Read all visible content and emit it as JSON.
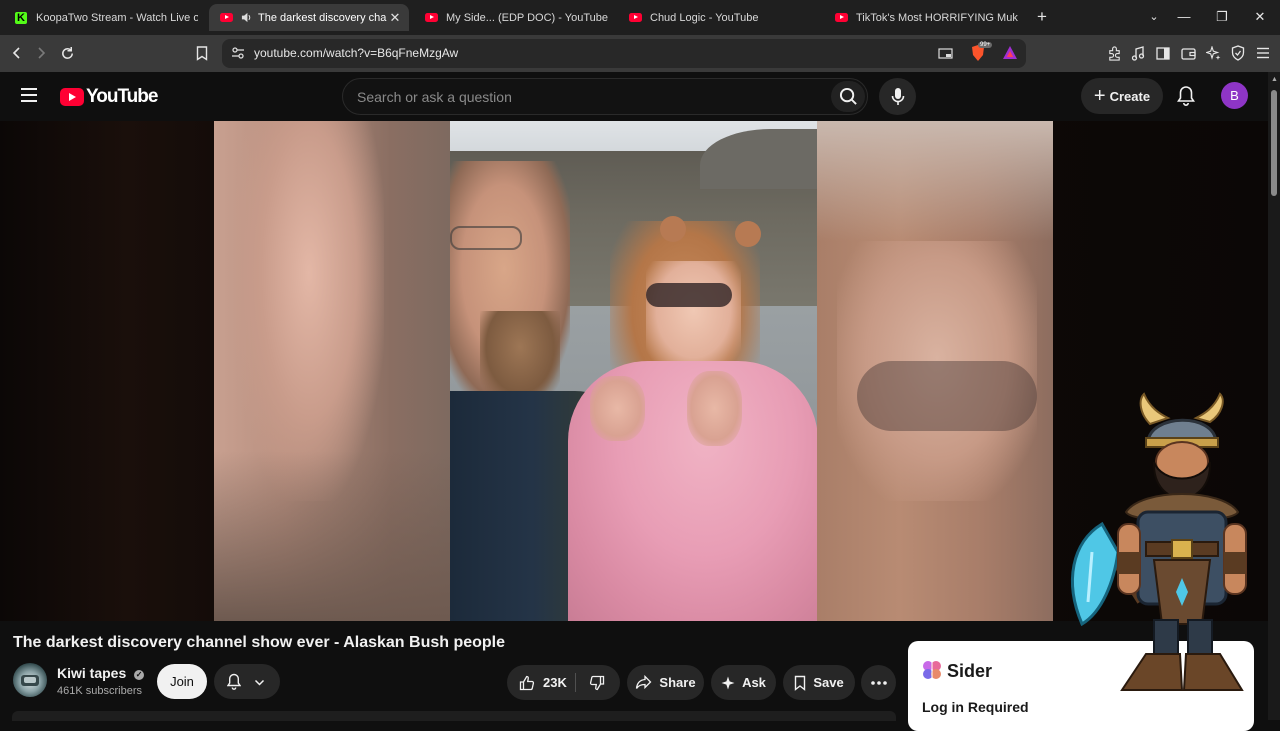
{
  "browser": {
    "tabs": [
      {
        "title": "KoopaTwo Stream - Watch Live o",
        "favicon": "kick-icon",
        "active": false
      },
      {
        "title": "The darkest discovery channe",
        "favicon": "youtube-icon",
        "active": true,
        "audio": true
      },
      {
        "title": "My Side... (EDP DOC) - YouTube",
        "favicon": "youtube-icon",
        "active": false
      },
      {
        "title": "Chud Logic - YouTube",
        "favicon": "youtube-icon",
        "active": false
      },
      {
        "title": "TikTok's Most HORRIFYING Mukbang",
        "favicon": "youtube-icon",
        "active": false
      }
    ],
    "url": "youtube.com/watch?v=B6qFneMzgAw",
    "brave_badge": "99+"
  },
  "youtube": {
    "logo_text": "YouTube",
    "search_placeholder": "Search or ask a question",
    "create_label": "Create",
    "avatar_letter": "B"
  },
  "video": {
    "title": "The darkest discovery channel show ever - Alaskan Bush people",
    "channel_name": "Kiwi tapes",
    "subscribers": "461K subscribers",
    "join_label": "Join",
    "likes": "23K",
    "share_label": "Share",
    "ask_label": "Ask",
    "save_label": "Save"
  },
  "sider": {
    "name": "Sider",
    "login_text": "Log in Required"
  },
  "colors": {
    "youtube_red": "#ff0033",
    "background": "#0f0f0f",
    "avatar_purple": "#8e35c6",
    "pink_sweater": "#e89db5"
  }
}
